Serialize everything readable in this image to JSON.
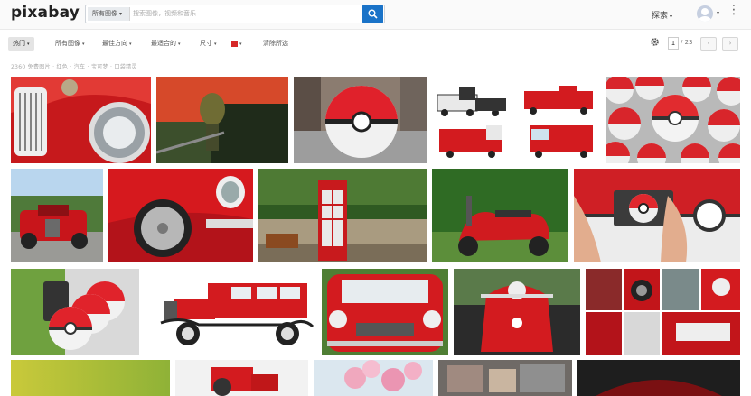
{
  "header": {
    "logo": "pixabay",
    "search": {
      "type_label": "所有图像",
      "placeholder": "搜索图像，视频和音乐"
    },
    "explore_label": "探索",
    "more_icon": "more-vertical-icon"
  },
  "filters": {
    "items": [
      "热门",
      "所有图像",
      "最佳方向",
      "最适合的",
      "尺寸",
      "颜色",
      "清除所选"
    ],
    "color_swatch": "#d62828"
  },
  "pagination": {
    "current": "1",
    "total": "/ 23",
    "prev": "‹",
    "next": "›"
  },
  "results_text": "2360 免费图片 · 红色 · 汽车 · 宝可梦 · 口袋精灵",
  "tiles": [
    {
      "subject": "red classic car headlight"
    },
    {
      "subject": "toy figure on red background"
    },
    {
      "subject": "pokeball on street"
    },
    {
      "subject": "red fire trucks"
    },
    {
      "subject": "pattern of pokeballs"
    },
    {
      "subject": "red vintage car front"
    },
    {
      "subject": "red sports car wheel"
    },
    {
      "subject": "red telephone booth"
    },
    {
      "subject": "red scooter on grass"
    },
    {
      "subject": "hands holding phone with pokeball"
    },
    {
      "subject": "pokeballs in spiral"
    },
    {
      "subject": "red vintage sedan"
    },
    {
      "subject": "red mini cooper"
    },
    {
      "subject": "red vespa scooter"
    },
    {
      "subject": "red car collage"
    },
    {
      "subject": "yellow gradient"
    },
    {
      "subject": "red tractor"
    },
    {
      "subject": "pink blossoms"
    },
    {
      "subject": "graffiti wall"
    },
    {
      "subject": "dark red car"
    }
  ]
}
